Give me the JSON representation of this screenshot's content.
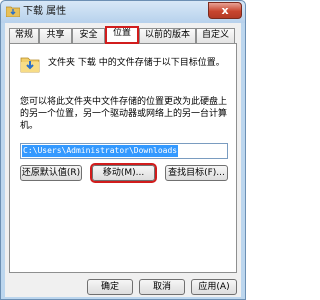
{
  "window": {
    "title": "下载 属性",
    "close_symbol": "x"
  },
  "tabs": [
    {
      "label": "常规"
    },
    {
      "label": "共享"
    },
    {
      "label": "安全"
    },
    {
      "label": "位置"
    },
    {
      "label": "以前的版本"
    },
    {
      "label": "自定义"
    }
  ],
  "active_tab": "位置",
  "location": {
    "info_text": "文件夹 下载 中的文件存储于以下目标位置。",
    "description": "您可以将此文件夹中文件存储的位置更改为此硬盘上的另一个位置，另一个驱动器或网络上的另一台计算机。",
    "path_value": "C:\\Users\\Administrator\\Downloads",
    "restore_default_label": "还原默认值(R)",
    "move_label": "移动(M)...",
    "find_target_label": "查找目标(F)..."
  },
  "footer": {
    "ok_label": "确定",
    "cancel_label": "取消",
    "apply_label": "应用(A)"
  },
  "colors": {
    "highlight_red": "#d11c1c",
    "selection_blue": "#3399ff",
    "close_red": "#c8452f"
  },
  "icons": {
    "title": "folder-download-icon",
    "info": "folder-download-icon",
    "close": "close-icon"
  }
}
